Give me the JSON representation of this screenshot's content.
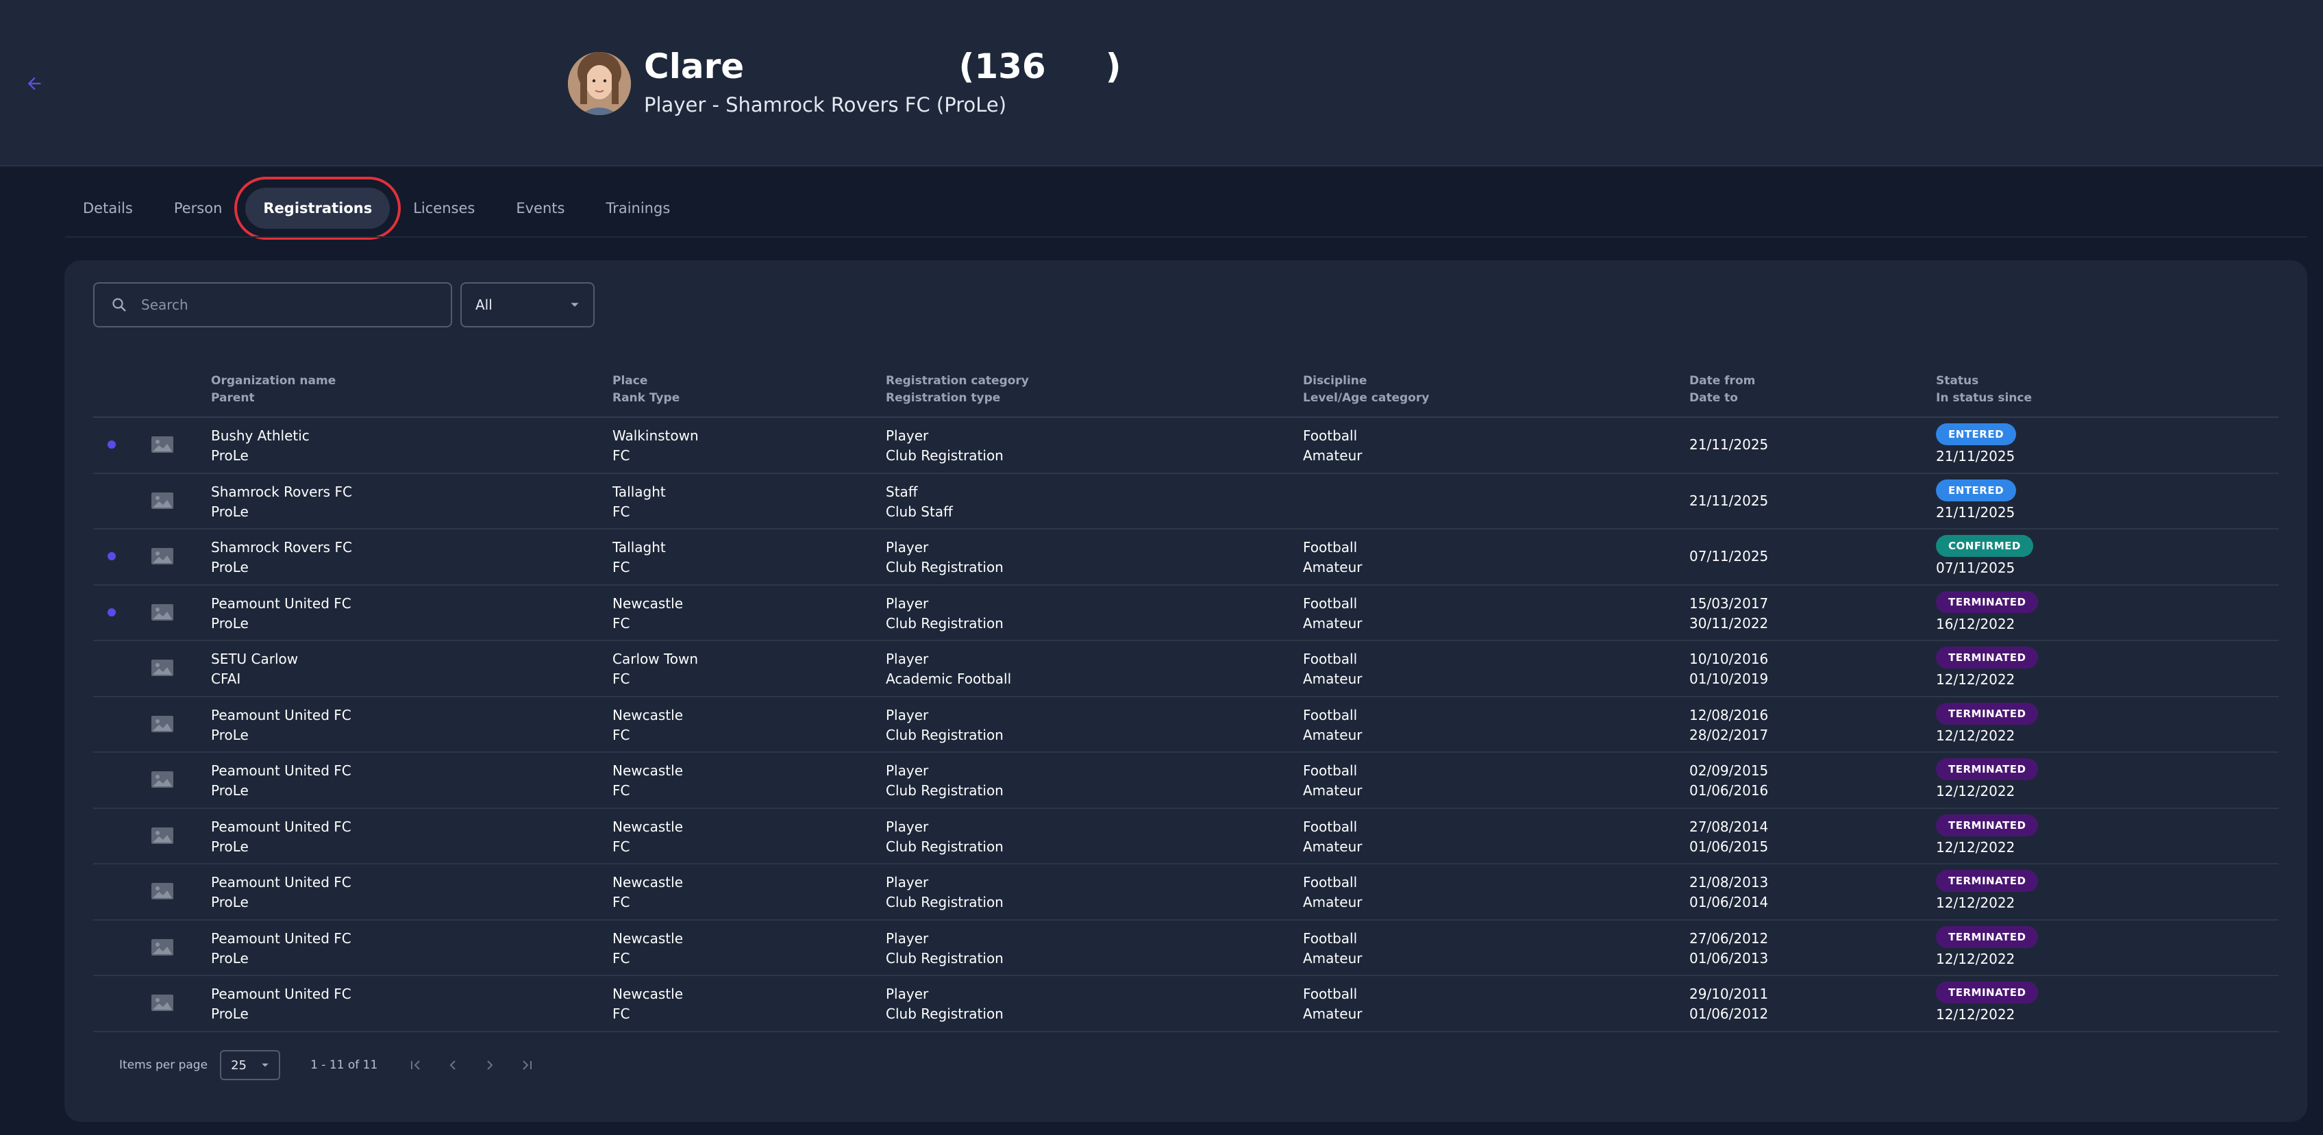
{
  "header": {
    "name": "Clare                  (136     )",
    "subtitle": "Player - Shamrock Rovers FC (ProLe)"
  },
  "tabs": [
    {
      "label": "Details",
      "active": false
    },
    {
      "label": "Person",
      "active": false
    },
    {
      "label": "Registrations",
      "active": true
    },
    {
      "label": "Licenses",
      "active": false
    },
    {
      "label": "Events",
      "active": false
    },
    {
      "label": "Trainings",
      "active": false
    }
  ],
  "search": {
    "placeholder": "Search",
    "value": ""
  },
  "filter": {
    "selected": "All"
  },
  "columns": {
    "org": [
      "Organization name",
      "Parent"
    ],
    "place": [
      "Place",
      "Rank Type"
    ],
    "category": [
      "Registration category",
      "Registration type"
    ],
    "discipline": [
      "Discipline",
      "Level/Age category"
    ],
    "dates": [
      "Date from",
      "Date to"
    ],
    "status": [
      "Status",
      "In status since"
    ]
  },
  "rows": [
    {
      "dot": true,
      "org": "Bushy Athletic",
      "parent": "ProLe",
      "place": "Walkinstown",
      "rank": "FC",
      "category": "Player",
      "type": "Club Registration",
      "discipline": "Football",
      "level": "Amateur",
      "date_from": "21/11/2025",
      "date_to": "",
      "status": "ENTERED",
      "status_since": "21/11/2025"
    },
    {
      "dot": false,
      "org": "Shamrock Rovers FC",
      "parent": "ProLe",
      "place": "Tallaght",
      "rank": "FC",
      "category": "Staff",
      "type": "Club Staff",
      "discipline": "",
      "level": "",
      "date_from": "21/11/2025",
      "date_to": "",
      "status": "ENTERED",
      "status_since": "21/11/2025"
    },
    {
      "dot": true,
      "org": "Shamrock Rovers FC",
      "parent": "ProLe",
      "place": "Tallaght",
      "rank": "FC",
      "category": "Player",
      "type": "Club Registration",
      "discipline": "Football",
      "level": "Amateur",
      "date_from": "07/11/2025",
      "date_to": "",
      "status": "CONFIRMED",
      "status_since": "07/11/2025"
    },
    {
      "dot": true,
      "org": "Peamount United FC",
      "parent": "ProLe",
      "place": "Newcastle",
      "rank": "FC",
      "category": "Player",
      "type": "Club Registration",
      "discipline": "Football",
      "level": "Amateur",
      "date_from": "15/03/2017",
      "date_to": "30/11/2022",
      "status": "TERMINATED",
      "status_since": "16/12/2022"
    },
    {
      "dot": false,
      "org": "SETU Carlow",
      "parent": "CFAI",
      "place": "Carlow Town",
      "rank": "FC",
      "category": "Player",
      "type": "Academic Football",
      "discipline": "Football",
      "level": "Amateur",
      "date_from": "10/10/2016",
      "date_to": "01/10/2019",
      "status": "TERMINATED",
      "status_since": "12/12/2022"
    },
    {
      "dot": false,
      "org": "Peamount United FC",
      "parent": "ProLe",
      "place": "Newcastle",
      "rank": "FC",
      "category": "Player",
      "type": "Club Registration",
      "discipline": "Football",
      "level": "Amateur",
      "date_from": "12/08/2016",
      "date_to": "28/02/2017",
      "status": "TERMINATED",
      "status_since": "12/12/2022"
    },
    {
      "dot": false,
      "org": "Peamount United FC",
      "parent": "ProLe",
      "place": "Newcastle",
      "rank": "FC",
      "category": "Player",
      "type": "Club Registration",
      "discipline": "Football",
      "level": "Amateur",
      "date_from": "02/09/2015",
      "date_to": "01/06/2016",
      "status": "TERMINATED",
      "status_since": "12/12/2022"
    },
    {
      "dot": false,
      "org": "Peamount United FC",
      "parent": "ProLe",
      "place": "Newcastle",
      "rank": "FC",
      "category": "Player",
      "type": "Club Registration",
      "discipline": "Football",
      "level": "Amateur",
      "date_from": "27/08/2014",
      "date_to": "01/06/2015",
      "status": "TERMINATED",
      "status_since": "12/12/2022"
    },
    {
      "dot": false,
      "org": "Peamount United FC",
      "parent": "ProLe",
      "place": "Newcastle",
      "rank": "FC",
      "category": "Player",
      "type": "Club Registration",
      "discipline": "Football",
      "level": "Amateur",
      "date_from": "21/08/2013",
      "date_to": "01/06/2014",
      "status": "TERMINATED",
      "status_since": "12/12/2022"
    },
    {
      "dot": false,
      "org": "Peamount United FC",
      "parent": "ProLe",
      "place": "Newcastle",
      "rank": "FC",
      "category": "Player",
      "type": "Club Registration",
      "discipline": "Football",
      "level": "Amateur",
      "date_from": "27/06/2012",
      "date_to": "01/06/2013",
      "status": "TERMINATED",
      "status_since": "12/12/2022"
    },
    {
      "dot": false,
      "org": "Peamount United FC",
      "parent": "ProLe",
      "place": "Newcastle",
      "rank": "FC",
      "category": "Player",
      "type": "Club Registration",
      "discipline": "Football",
      "level": "Amateur",
      "date_from": "29/10/2011",
      "date_to": "01/06/2012",
      "status": "TERMINATED",
      "status_since": "12/12/2022"
    }
  ],
  "status_colors": {
    "ENTERED": "#2f86e8",
    "CONFIRMED": "#138a80",
    "TERMINATED": "#4a1572"
  },
  "pagination": {
    "items_per_page_label": "Items per page",
    "items_per_page": "25",
    "range": "1 - 11 of 11"
  },
  "icons": {
    "back": "arrow-left-icon",
    "search": "search-icon",
    "dropdown": "caret-down-icon",
    "image": "image-placeholder-icon"
  }
}
